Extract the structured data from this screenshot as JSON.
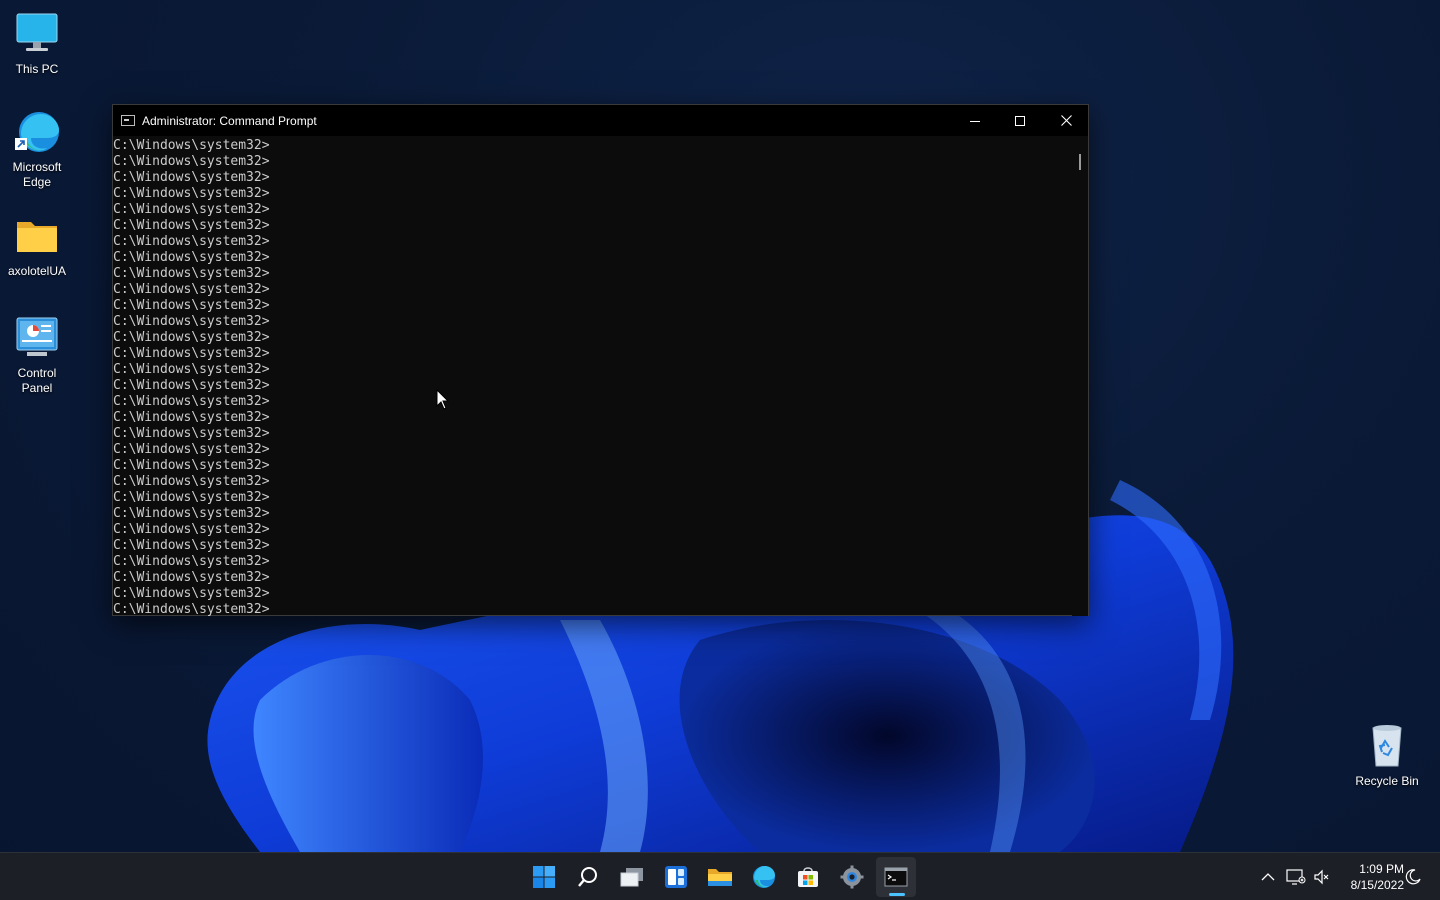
{
  "desktop": {
    "icons": [
      {
        "label": "This PC"
      },
      {
        "label": "Microsoft Edge"
      },
      {
        "label": "axolotelUA"
      },
      {
        "label": "Control Panel"
      },
      {
        "label": "Recycle Bin"
      }
    ]
  },
  "window": {
    "title": "Administrator: Command Prompt",
    "prompt": "C:\\Windows\\system32>",
    "line_count": 30
  },
  "taskbar": {
    "apps": [
      "start-icon",
      "search-icon",
      "task-view-icon",
      "widgets-icon",
      "file-explorer-icon",
      "edge-icon",
      "store-icon",
      "settings-icon",
      "terminal-icon"
    ],
    "clock": {
      "time": "1:09 PM",
      "date": "8/15/2022"
    }
  },
  "colors": {
    "console_bg": "#0c0c0c",
    "console_fg": "#cccccc",
    "accent": "#4cc2ff"
  }
}
